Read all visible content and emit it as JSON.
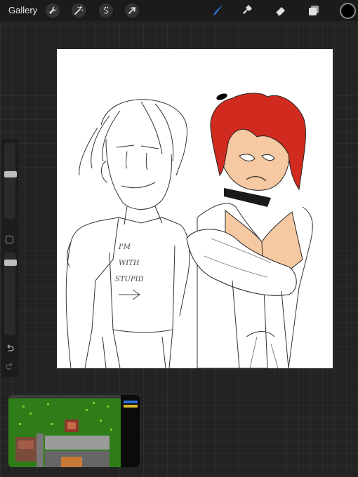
{
  "toolbar": {
    "gallery_label": "Gallery",
    "left_tools": [
      {
        "name": "actions",
        "icon": "wrench-icon"
      },
      {
        "name": "adjustments",
        "icon": "magic-wand-icon"
      },
      {
        "name": "selection",
        "icon": "selection-s-icon"
      },
      {
        "name": "transform",
        "icon": "arrow-cursor-icon"
      }
    ],
    "right_tools": [
      {
        "name": "brush",
        "icon": "brush-icon",
        "active": true
      },
      {
        "name": "smudge",
        "icon": "smudge-icon"
      },
      {
        "name": "eraser",
        "icon": "eraser-icon"
      },
      {
        "name": "layers",
        "icon": "layers-icon"
      }
    ],
    "active_tool_color": "#2f7df6",
    "current_color": "#000000"
  },
  "sidebar": {
    "brush_size_level": 0.15,
    "opacity_level": 0.05,
    "modify_button_icon": "square-icon",
    "undo_icon": "undo-arrow-icon",
    "redo_icon": "redo-arrow-icon"
  },
  "canvas": {
    "background": "#ffffff",
    "hair_color": "#d12a1f",
    "skin_color": "#f6c9a3",
    "shirt_text": [
      "I'M",
      "WITH",
      "STUPID"
    ]
  },
  "thumbnail": {
    "description_icon": "game-screenshot-thumbnail",
    "grass_color": "#2e7d19"
  }
}
